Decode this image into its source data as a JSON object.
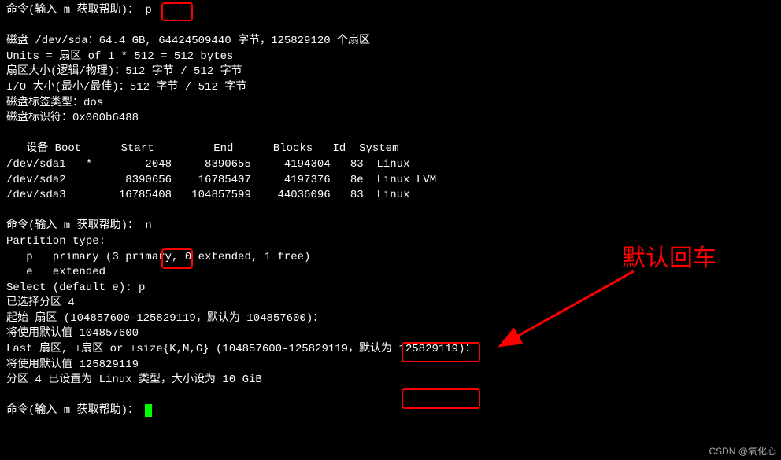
{
  "prompt1_prefix": "命令(输入 m 获取帮助)：",
  "prompt1_input": "p",
  "disk_line": "磁盘 /dev/sda：64.4 GB, 64424509440 字节，125829120 个扇区",
  "units_line": "Units = 扇区 of 1 * 512 = 512 bytes",
  "sector_size_line": "扇区大小(逻辑/物理)：512 字节 / 512 字节",
  "io_size_line": "I/O 大小(最小/最佳)：512 字节 / 512 字节",
  "disk_label_line": "磁盘标签类型：dos",
  "disk_id_line": "磁盘标识符：0x000b6488",
  "part_header_line": "   设备 Boot      Start         End      Blocks   Id  System",
  "part_rows": [
    "/dev/sda1   *        2048     8390655     4194304   83  Linux",
    "/dev/sda2         8390656    16785407     4197376   8e  Linux LVM",
    "/dev/sda3        16785408   104857599    44036096   83  Linux"
  ],
  "prompt2_prefix": "命令(输入 m 获取帮助)：",
  "prompt2_input": "n",
  "ptype_header": "Partition type:",
  "ptype_p": "   p   primary (3 primary, 0 extended, 1 free)",
  "ptype_e": "   e   extended",
  "select_line_prefix": "Select (default e): ",
  "select_input": "p",
  "selected_part": "已选择分区 4",
  "start_sector_prompt": "起始 扇区 (104857600-125829119，默认为 104857600)：",
  "use_default_start": "将使用默认值 104857600",
  "last_sector_prompt": "Last 扇区, +扇区 or +size{K,M,G} (104857600-125829119，默认为 125829119)：",
  "use_default_last": "将使用默认值 125829119",
  "result_line": "分区 4 已设置为 Linux 类型，大小设为 10 GiB",
  "prompt3_prefix": "命令(输入 m 获取帮助)：",
  "annotation_text": "默认回车",
  "watermark": "CSDN @氧化心"
}
